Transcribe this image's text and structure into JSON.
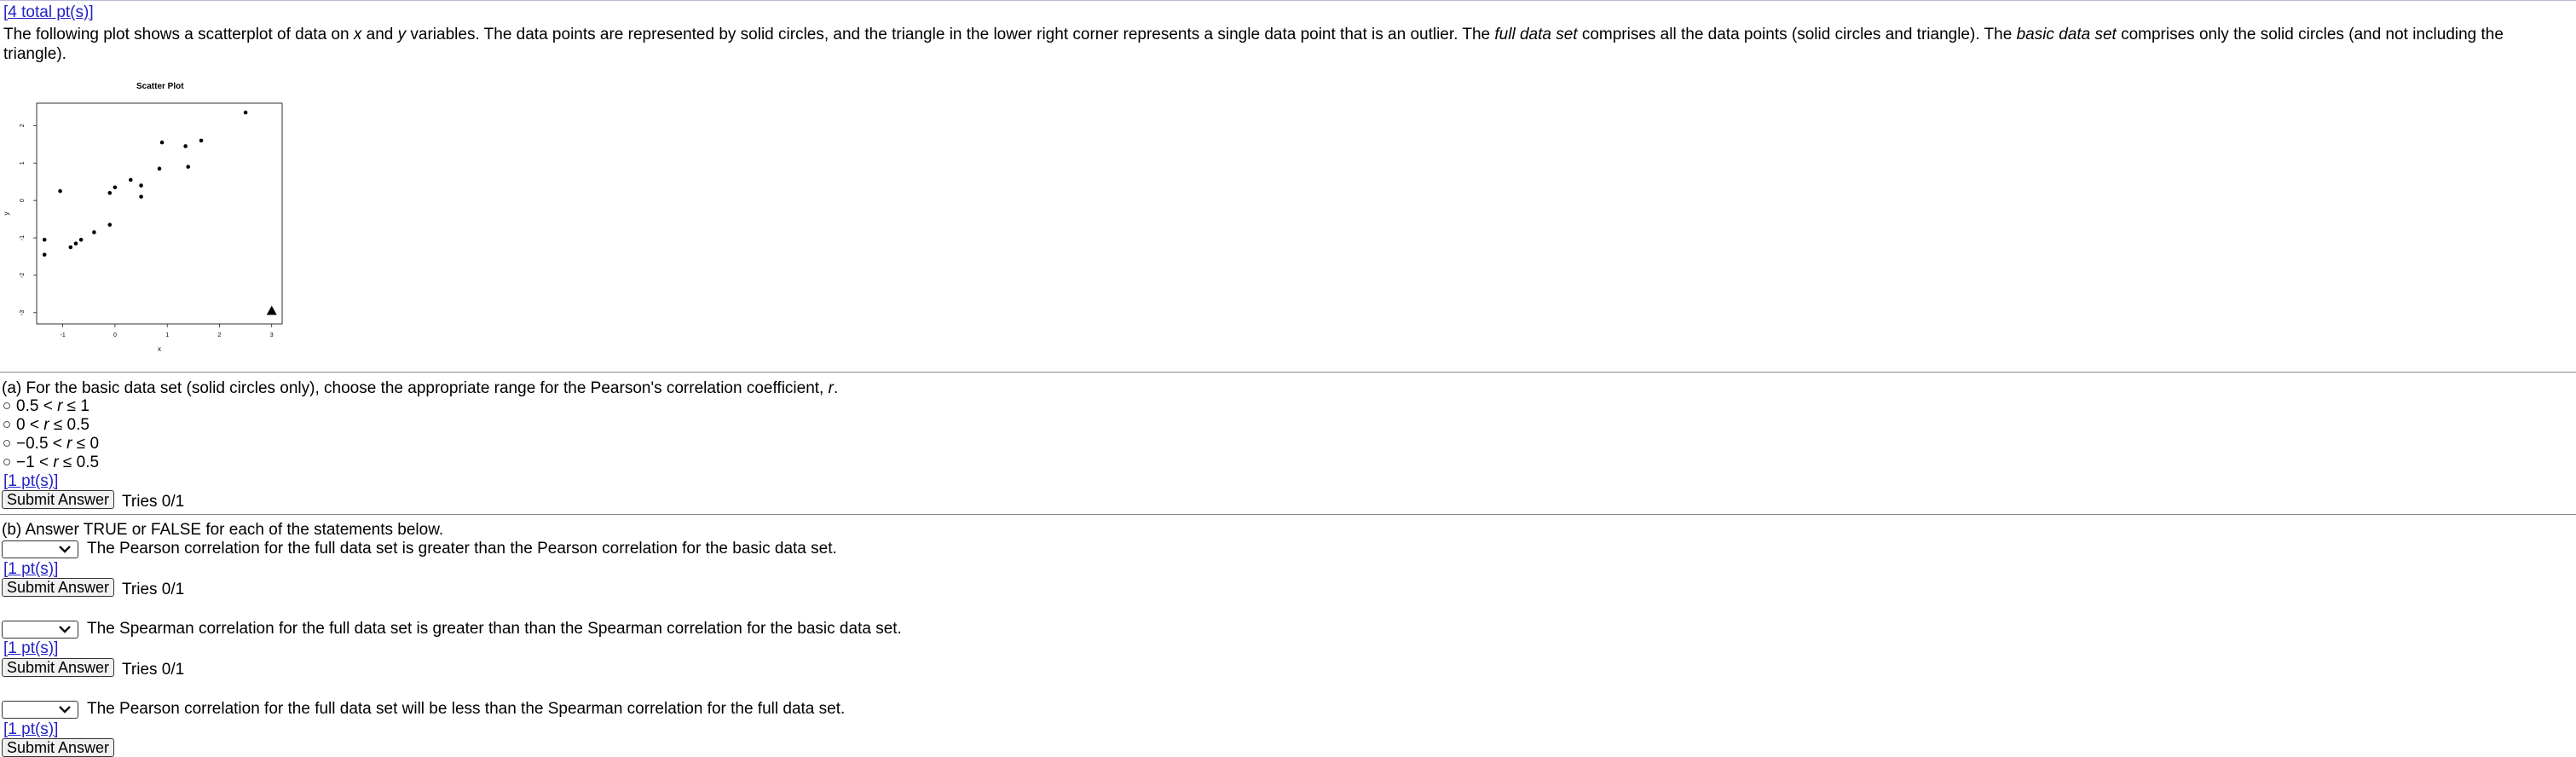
{
  "header": {
    "total_points": "[4 total pt(s)]"
  },
  "intro": {
    "text_1": "The following plot shows a scatterplot of data on ",
    "var_x": "x",
    "text_2": " and ",
    "var_y": "y",
    "text_3": " variables. The data points are represented by solid circles, and the triangle in the lower right corner represents a single data point that is an outlier. The ",
    "full_term": "full data set",
    "text_4": " comprises all the data points (solid circles and triangle). The ",
    "basic_term": "basic data set",
    "text_5": " comprises only the solid circles (and not including the triangle)."
  },
  "chart_data": {
    "type": "scatter",
    "title": "Scatter Plot",
    "xlabel": "x",
    "ylabel": "y",
    "xlim": [
      -1.5,
      3.2
    ],
    "ylim": [
      -3.3,
      2.6
    ],
    "x_ticks": [
      "-1",
      "0",
      "1",
      "2",
      "3"
    ],
    "y_ticks": [
      "-3",
      "-2",
      "-1",
      "0",
      "1",
      "2"
    ],
    "series": [
      {
        "marker": "circle",
        "points": [
          [
            -1.35,
            -1.45
          ],
          [
            -1.35,
            -1.05
          ],
          [
            -1.05,
            0.25
          ],
          [
            -0.85,
            -1.25
          ],
          [
            -0.75,
            -1.15
          ],
          [
            -0.65,
            -1.05
          ],
          [
            -0.4,
            -0.85
          ],
          [
            -0.1,
            -0.65
          ],
          [
            -0.1,
            0.2
          ],
          [
            0.0,
            0.35
          ],
          [
            0.3,
            0.55
          ],
          [
            0.5,
            0.1
          ],
          [
            0.5,
            0.4
          ],
          [
            0.85,
            0.85
          ],
          [
            0.9,
            1.55
          ],
          [
            1.35,
            1.45
          ],
          [
            1.4,
            0.9
          ],
          [
            1.65,
            1.6
          ],
          [
            2.5,
            2.35
          ]
        ]
      },
      {
        "marker": "triangle",
        "points": [
          [
            3.0,
            -2.95
          ]
        ]
      }
    ]
  },
  "part_a": {
    "question_1": "(a) For the basic data set (solid circles only), choose the appropriate range for the Pearson's correlation coefficient, ",
    "question_var": "r",
    "question_2": ".",
    "options": [
      {
        "lo": "0.5 < ",
        "var": "r",
        "hi": " ≤ 1"
      },
      {
        "lo": "0 < ",
        "var": "r",
        "hi": " ≤ 0.5"
      },
      {
        "lo": "−0.5 < ",
        "var": "r",
        "hi": " ≤ 0"
      },
      {
        "lo": "−1 < ",
        "var": "r",
        "hi": " ≤ 0.5"
      }
    ],
    "points": "[1 pt(s)]",
    "submit": "Submit Answer",
    "tries": "Tries 0/1"
  },
  "part_b": {
    "intro": "(b) Answer TRUE or FALSE for each of the statements below.",
    "statements": [
      {
        "text": "The Pearson correlation for the full data set is greater than the Pearson correlation for the basic data set.",
        "selected": "",
        "points": "[1 pt(s)]",
        "submit": "Submit Answer",
        "tries": "Tries 0/1"
      },
      {
        "text": "The Spearman correlation for the full data set is greater than than the Spearman correlation for the basic data set.",
        "selected": "",
        "points": "[1 pt(s)]",
        "submit": "Submit Answer",
        "tries": "Tries 0/1"
      },
      {
        "text": "The Pearson correlation for the full data set will be less than the Spearman correlation for the full data set.",
        "selected": "",
        "points": "[1 pt(s)]",
        "submit": "Submit Answer",
        "tries": ""
      }
    ]
  }
}
